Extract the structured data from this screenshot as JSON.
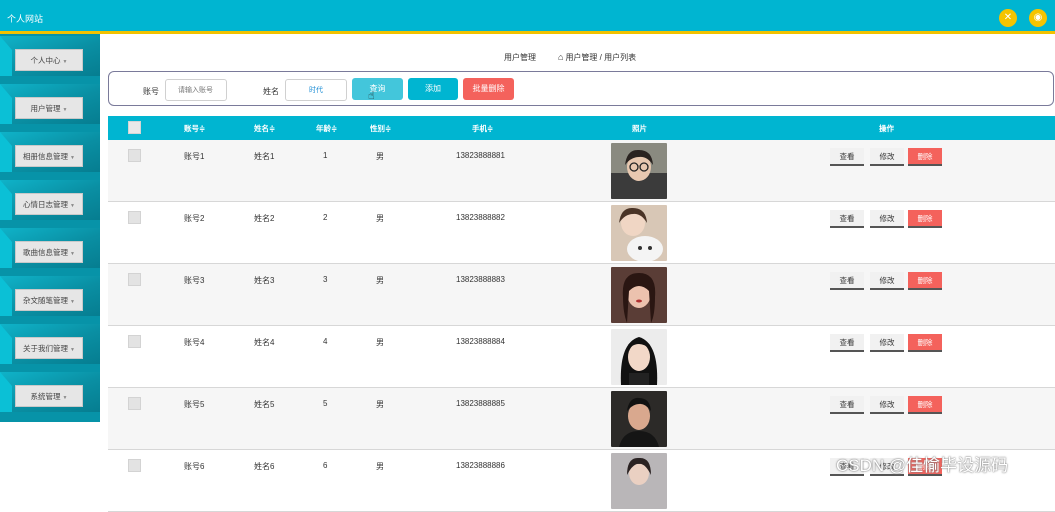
{
  "app": {
    "title": "个人网站"
  },
  "topbar": {
    "icons": [
      "fullscreen-icon",
      "user-icon"
    ],
    "color": "#00b5d1",
    "accent": "#f2c200"
  },
  "sidebar": {
    "items": [
      {
        "label": "个人中心"
      },
      {
        "label": "用户管理"
      },
      {
        "label": "相册信息管理"
      },
      {
        "label": "心情日志管理"
      },
      {
        "label": "歌曲信息管理"
      },
      {
        "label": "杂文随笔管理"
      },
      {
        "label": "关于我们管理"
      },
      {
        "label": "系统管理"
      }
    ]
  },
  "breadcrumb": {
    "title": "用户管理",
    "path": "用户管理 / 用户列表"
  },
  "search": {
    "account_label": "账号",
    "account_placeholder": "请输入账号",
    "name_label": "姓名",
    "name_value": "时代",
    "query_button": "查询",
    "add_button": "添加",
    "batch_delete_button": "批量删除"
  },
  "table": {
    "headers": {
      "account": "账号≑",
      "name": "姓名≑",
      "age": "年龄≑",
      "gender": "性别≑",
      "phone": "手机≑",
      "photo": "照片",
      "actions": "操作"
    },
    "actions": {
      "view": "查看",
      "edit": "修改",
      "delete": "删除"
    },
    "rows": [
      {
        "account": "账号1",
        "name": "姓名1",
        "age": "1",
        "gender": "男",
        "phone": "13823888881"
      },
      {
        "account": "账号2",
        "name": "姓名2",
        "age": "2",
        "gender": "男",
        "phone": "13823888882"
      },
      {
        "account": "账号3",
        "name": "姓名3",
        "age": "3",
        "gender": "男",
        "phone": "13823888883"
      },
      {
        "account": "账号4",
        "name": "姓名4",
        "age": "4",
        "gender": "男",
        "phone": "13823888884"
      },
      {
        "account": "账号5",
        "name": "姓名5",
        "age": "5",
        "gender": "男",
        "phone": "13823888885"
      },
      {
        "account": "账号6",
        "name": "姓名6",
        "age": "6",
        "gender": "男",
        "phone": "13823888886"
      }
    ]
  },
  "watermark": "CSDN @佳愉毕设源码"
}
